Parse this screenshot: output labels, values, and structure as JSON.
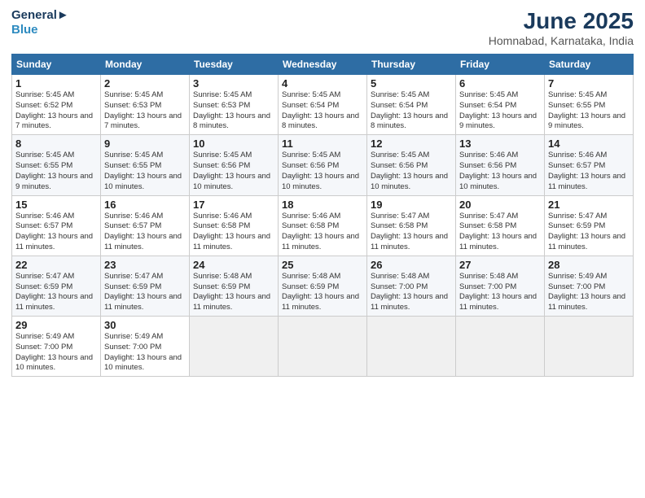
{
  "header": {
    "logo_line1": "General",
    "logo_line2": "Blue",
    "month": "June 2025",
    "location": "Homnabad, Karnataka, India"
  },
  "weekdays": [
    "Sunday",
    "Monday",
    "Tuesday",
    "Wednesday",
    "Thursday",
    "Friday",
    "Saturday"
  ],
  "weeks": [
    [
      {
        "day": "1",
        "sr": "5:45 AM",
        "ss": "6:52 PM",
        "dl": "13 hours and 7 minutes."
      },
      {
        "day": "2",
        "sr": "5:45 AM",
        "ss": "6:53 PM",
        "dl": "13 hours and 7 minutes."
      },
      {
        "day": "3",
        "sr": "5:45 AM",
        "ss": "6:53 PM",
        "dl": "13 hours and 8 minutes."
      },
      {
        "day": "4",
        "sr": "5:45 AM",
        "ss": "6:54 PM",
        "dl": "13 hours and 8 minutes."
      },
      {
        "day": "5",
        "sr": "5:45 AM",
        "ss": "6:54 PM",
        "dl": "13 hours and 8 minutes."
      },
      {
        "day": "6",
        "sr": "5:45 AM",
        "ss": "6:54 PM",
        "dl": "13 hours and 9 minutes."
      },
      {
        "day": "7",
        "sr": "5:45 AM",
        "ss": "6:55 PM",
        "dl": "13 hours and 9 minutes."
      }
    ],
    [
      {
        "day": "8",
        "sr": "5:45 AM",
        "ss": "6:55 PM",
        "dl": "13 hours and 9 minutes."
      },
      {
        "day": "9",
        "sr": "5:45 AM",
        "ss": "6:55 PM",
        "dl": "13 hours and 10 minutes."
      },
      {
        "day": "10",
        "sr": "5:45 AM",
        "ss": "6:56 PM",
        "dl": "13 hours and 10 minutes."
      },
      {
        "day": "11",
        "sr": "5:45 AM",
        "ss": "6:56 PM",
        "dl": "13 hours and 10 minutes."
      },
      {
        "day": "12",
        "sr": "5:45 AM",
        "ss": "6:56 PM",
        "dl": "13 hours and 10 minutes."
      },
      {
        "day": "13",
        "sr": "5:46 AM",
        "ss": "6:56 PM",
        "dl": "13 hours and 10 minutes."
      },
      {
        "day": "14",
        "sr": "5:46 AM",
        "ss": "6:57 PM",
        "dl": "13 hours and 11 minutes."
      }
    ],
    [
      {
        "day": "15",
        "sr": "5:46 AM",
        "ss": "6:57 PM",
        "dl": "13 hours and 11 minutes."
      },
      {
        "day": "16",
        "sr": "5:46 AM",
        "ss": "6:57 PM",
        "dl": "13 hours and 11 minutes."
      },
      {
        "day": "17",
        "sr": "5:46 AM",
        "ss": "6:58 PM",
        "dl": "13 hours and 11 minutes."
      },
      {
        "day": "18",
        "sr": "5:46 AM",
        "ss": "6:58 PM",
        "dl": "13 hours and 11 minutes."
      },
      {
        "day": "19",
        "sr": "5:47 AM",
        "ss": "6:58 PM",
        "dl": "13 hours and 11 minutes."
      },
      {
        "day": "20",
        "sr": "5:47 AM",
        "ss": "6:58 PM",
        "dl": "13 hours and 11 minutes."
      },
      {
        "day": "21",
        "sr": "5:47 AM",
        "ss": "6:59 PM",
        "dl": "13 hours and 11 minutes."
      }
    ],
    [
      {
        "day": "22",
        "sr": "5:47 AM",
        "ss": "6:59 PM",
        "dl": "13 hours and 11 minutes."
      },
      {
        "day": "23",
        "sr": "5:47 AM",
        "ss": "6:59 PM",
        "dl": "13 hours and 11 minutes."
      },
      {
        "day": "24",
        "sr": "5:48 AM",
        "ss": "6:59 PM",
        "dl": "13 hours and 11 minutes."
      },
      {
        "day": "25",
        "sr": "5:48 AM",
        "ss": "6:59 PM",
        "dl": "13 hours and 11 minutes."
      },
      {
        "day": "26",
        "sr": "5:48 AM",
        "ss": "7:00 PM",
        "dl": "13 hours and 11 minutes."
      },
      {
        "day": "27",
        "sr": "5:48 AM",
        "ss": "7:00 PM",
        "dl": "13 hours and 11 minutes."
      },
      {
        "day": "28",
        "sr": "5:49 AM",
        "ss": "7:00 PM",
        "dl": "13 hours and 11 minutes."
      }
    ],
    [
      {
        "day": "29",
        "sr": "5:49 AM",
        "ss": "7:00 PM",
        "dl": "13 hours and 10 minutes."
      },
      {
        "day": "30",
        "sr": "5:49 AM",
        "ss": "7:00 PM",
        "dl": "13 hours and 10 minutes."
      },
      null,
      null,
      null,
      null,
      null
    ]
  ],
  "labels": {
    "sunrise": "Sunrise:",
    "sunset": "Sunset:",
    "daylight": "Daylight:"
  }
}
